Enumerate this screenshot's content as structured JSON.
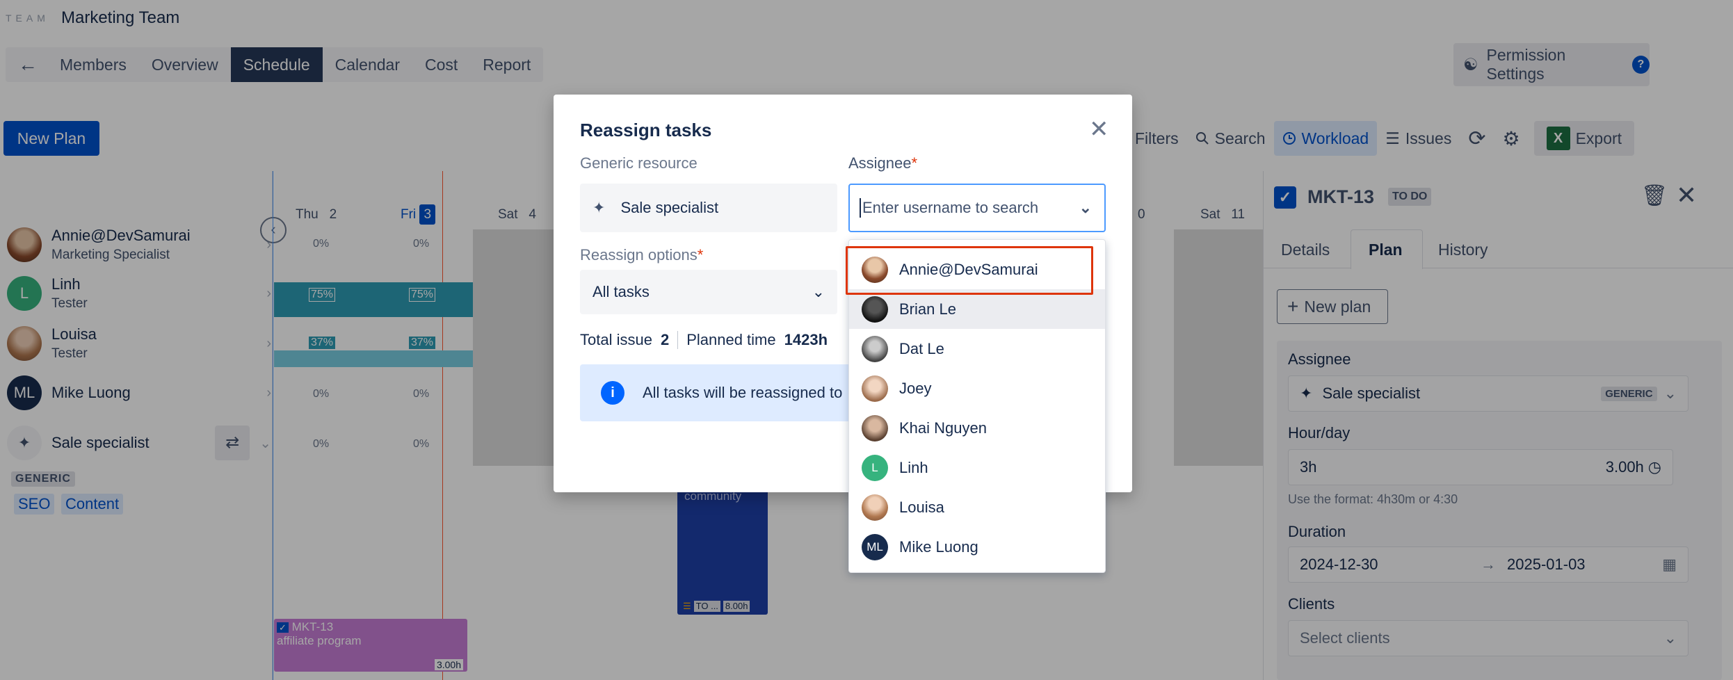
{
  "header": {
    "team_label": "TEAM",
    "team_name": "Marketing Team"
  },
  "nav": {
    "back_icon": "arrow-left-icon",
    "tabs": [
      "Members",
      "Overview",
      "Schedule",
      "Calendar",
      "Cost",
      "Report"
    ],
    "active": "Schedule",
    "permission_settings": "Permission Settings",
    "help": "?"
  },
  "toolbar": {
    "new_plan": "New Plan",
    "filters": "Filters",
    "search": "Search",
    "workload": "Workload",
    "issues": "Issues",
    "export": "Export",
    "xls": "X"
  },
  "resources": [
    {
      "name": "Annie@DevSamurai",
      "role": "Marketing Specialist",
      "initials": ""
    },
    {
      "name": "Linh",
      "role": "Tester",
      "initials": "L"
    },
    {
      "name": "Louisa",
      "role": "Tester",
      "initials": ""
    },
    {
      "name": "Mike Luong",
      "role": "",
      "initials": "ML"
    },
    {
      "name": "Sale specialist",
      "role": "",
      "initials": ""
    }
  ],
  "generic_tag": "GENERIC",
  "skills": [
    "SEO",
    "Content"
  ],
  "calendar": {
    "days": [
      {
        "dow": "Thu",
        "num": "2"
      },
      {
        "dow": "Fri",
        "num": "3"
      },
      {
        "dow": "Sat",
        "num": "4"
      },
      {
        "dow": "Sat",
        "num": "11"
      }
    ],
    "partial_day": "0",
    "cells": {
      "annie": [
        "0%",
        "0%"
      ],
      "linh": [
        "75%",
        "75%"
      ],
      "louisa": [
        "37%",
        "37%"
      ],
      "mike": [
        "0%",
        "0%"
      ],
      "sale": [
        "0%",
        "0%"
      ]
    },
    "task_card": {
      "key": "MKT-13",
      "title": "affiliate program",
      "hours": "3.00h"
    },
    "blue_card": {
      "text": "community",
      "status": "TO ...",
      "hours": "8.00h"
    }
  },
  "modal": {
    "title": "Reassign tasks",
    "generic_resource_label": "Generic resource",
    "generic_resource_value": "Sale specialist",
    "assignee_label": "Assignee",
    "required_mark": "*",
    "assignee_placeholder": "Enter username to search",
    "reassign_options_label": "Reassign options",
    "reassign_options_value": "All tasks",
    "total_issue_label": "Total issue",
    "total_issue_value": "2",
    "planned_time_label": "Planned time",
    "planned_time_value": "1423h",
    "info_text": "All tasks will be reassigned to"
  },
  "dropdown": {
    "options": [
      {
        "name": "Annie@DevSamurai",
        "initials": "",
        "av": "av-annie"
      },
      {
        "name": "Brian Le",
        "initials": "",
        "av": "av-brian"
      },
      {
        "name": "Dat Le",
        "initials": "",
        "av": "av-dat"
      },
      {
        "name": "Joey",
        "initials": "",
        "av": "av-joey"
      },
      {
        "name": "Khai Nguyen",
        "initials": "",
        "av": "av-khai"
      },
      {
        "name": "Linh",
        "initials": "L",
        "av": "av-linh"
      },
      {
        "name": "Louisa",
        "initials": "",
        "av": "av-louisa"
      },
      {
        "name": "Mike Luong",
        "initials": "ML",
        "av": "av-mike"
      }
    ],
    "hovered": "Brian Le",
    "highlighted": "Annie@DevSamurai"
  },
  "right_panel": {
    "issue_key": "MKT-13",
    "status": "TO DO",
    "tabs": [
      "Details",
      "Plan",
      "History"
    ],
    "active_tab": "Plan",
    "new_plan": "New plan",
    "assignee_label": "Assignee",
    "assignee_value": "Sale specialist",
    "assignee_tag": "GENERIC",
    "hourday_label": "Hour/day",
    "hourday_value": "3h",
    "hourday_computed": "3.00h",
    "hint": "Use the format: 4h30m or 4:30",
    "duration_label": "Duration",
    "duration_start": "2024-12-30",
    "duration_end": "2025-01-03",
    "clients_label": "Clients",
    "clients_placeholder": "Select clients"
  },
  "colors": {
    "primary": "#0052cc",
    "nav_active": "#253858",
    "highlight": "#de350b",
    "linh_bar": "#2d9cb4",
    "task_card": "#c77dd6",
    "blue_card": "#1e3fa8"
  }
}
